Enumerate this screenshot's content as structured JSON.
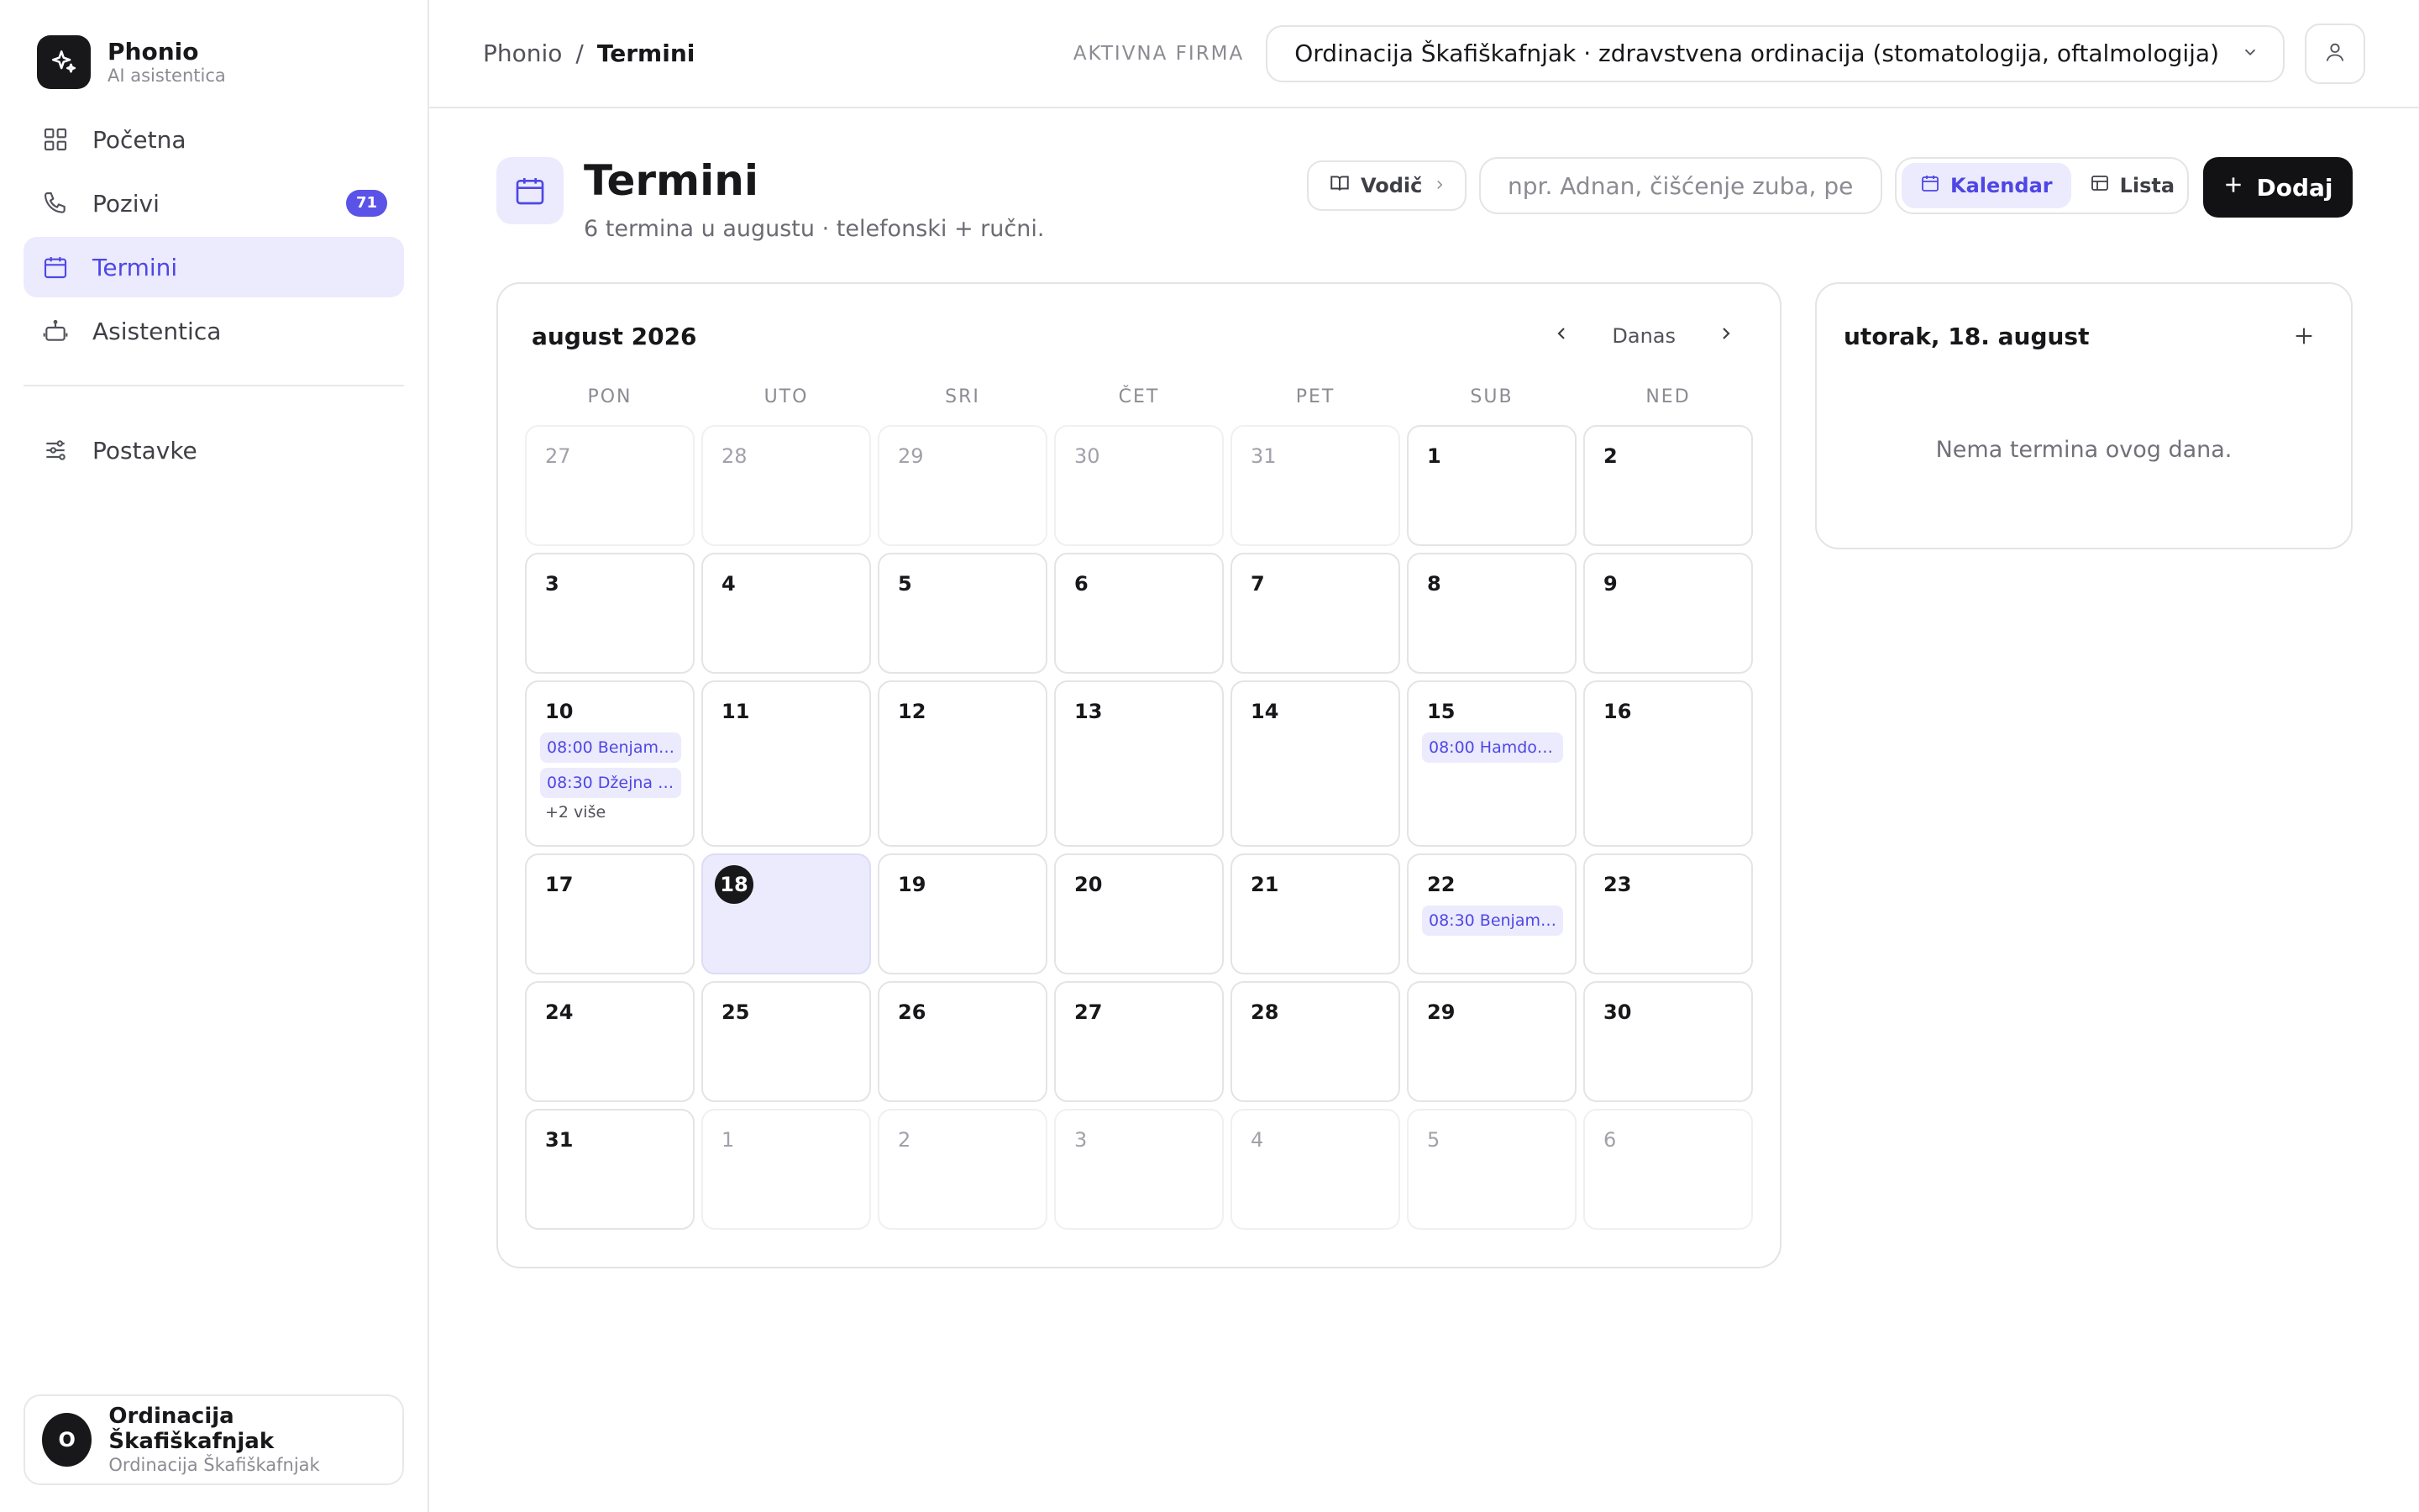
{
  "app": {
    "name": "Phonio",
    "subtitle": "AI asistentica"
  },
  "nav": {
    "items": [
      {
        "label": "Početna",
        "icon": "grid-icon"
      },
      {
        "label": "Pozivi",
        "icon": "phone-icon",
        "badge": "71"
      },
      {
        "label": "Termini",
        "icon": "calendar-icon",
        "active": true
      },
      {
        "label": "Asistentica",
        "icon": "bot-icon"
      }
    ],
    "settings": {
      "label": "Postavke",
      "icon": "sliders-icon"
    }
  },
  "account": {
    "initial": "O",
    "name": "Ordinacija Škafiškafnjak",
    "sub": "Ordinacija Škafiškafnjak"
  },
  "topbar": {
    "breadcrumb": [
      "Phonio",
      "/",
      "Termini"
    ],
    "firm_label": "AKTIVNA FIRMA",
    "firm_value": "Ordinacija Škafiškafnjak · zdravstvena ordinacija (stomatologija, oftalmologija)"
  },
  "page": {
    "title": "Termini",
    "subtitle": "6 termina u augustu · telefonski + ručni.",
    "guide_label": "Vodič",
    "search_placeholder": "npr. Adnan, čišćenje zuba, petak",
    "view_calendar": "Kalendar",
    "view_list": "Lista",
    "add_label": "Dodaj"
  },
  "calendar": {
    "month_label": "august 2026",
    "today_label": "Danas",
    "weekdays": [
      "PON",
      "UTO",
      "SRI",
      "ČET",
      "PET",
      "SUB",
      "NED"
    ],
    "weeks": [
      [
        {
          "d": "27",
          "m": true
        },
        {
          "d": "28",
          "m": true
        },
        {
          "d": "29",
          "m": true
        },
        {
          "d": "30",
          "m": true
        },
        {
          "d": "31",
          "m": true
        },
        {
          "d": "1"
        },
        {
          "d": "2"
        }
      ],
      [
        {
          "d": "3"
        },
        {
          "d": "4"
        },
        {
          "d": "5"
        },
        {
          "d": "6"
        },
        {
          "d": "7"
        },
        {
          "d": "8"
        },
        {
          "d": "9"
        }
      ],
      [
        {
          "d": "10",
          "events": [
            "08:00 Benjami…",
            "08:30 Džejna P…"
          ],
          "more": "+2 više"
        },
        {
          "d": "11"
        },
        {
          "d": "12"
        },
        {
          "d": "13"
        },
        {
          "d": "14"
        },
        {
          "d": "15",
          "events": [
            "08:00 Hamdo …"
          ]
        },
        {
          "d": "16"
        }
      ],
      [
        {
          "d": "17"
        },
        {
          "d": "18",
          "today": true
        },
        {
          "d": "19"
        },
        {
          "d": "20"
        },
        {
          "d": "21"
        },
        {
          "d": "22",
          "events": [
            "08:30 Benjami…"
          ]
        },
        {
          "d": "23"
        }
      ],
      [
        {
          "d": "24"
        },
        {
          "d": "25"
        },
        {
          "d": "26"
        },
        {
          "d": "27"
        },
        {
          "d": "28"
        },
        {
          "d": "29"
        },
        {
          "d": "30"
        }
      ],
      [
        {
          "d": "31"
        },
        {
          "d": "1",
          "m": true
        },
        {
          "d": "2",
          "m": true
        },
        {
          "d": "3",
          "m": true
        },
        {
          "d": "4",
          "m": true
        },
        {
          "d": "5",
          "m": true
        },
        {
          "d": "6",
          "m": true
        }
      ]
    ]
  },
  "day_panel": {
    "title": "utorak, 18. august",
    "empty": "Nema termina ovog dana."
  },
  "colors": {
    "accent": "#4f46e5",
    "accent_bg": "#ebebfd",
    "dark": "#18181b"
  }
}
